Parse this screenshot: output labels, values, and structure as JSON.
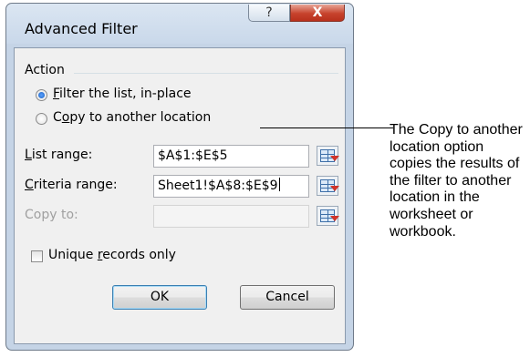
{
  "dialog": {
    "title": "Advanced Filter",
    "help_glyph": "?",
    "close_glyph": "X"
  },
  "action": {
    "label": "Action",
    "radio_filter": {
      "pre": "",
      "accel": "F",
      "post": "ilter the list, in-place",
      "selected": true
    },
    "radio_copy": {
      "pre": "C",
      "accel": "o",
      "post": "py to another location",
      "selected": false
    }
  },
  "list_range": {
    "pre": "",
    "accel": "L",
    "post": "ist range:",
    "value": "$A$1:$E$5"
  },
  "criteria_range": {
    "pre": "",
    "accel": "C",
    "post": "riteria range:",
    "value": "Sheet1!$A$8:$E$9"
  },
  "copy_to": {
    "label": "Copy to:",
    "value": "",
    "disabled": true
  },
  "unique": {
    "pre": "Unique ",
    "accel": "r",
    "post": "ecords only",
    "checked": false
  },
  "buttons": {
    "ok": "OK",
    "cancel": "Cancel"
  },
  "callout": {
    "text": "The Copy to another location option copies the results of the filter to another location in the worksheet or workbook."
  },
  "colors": {
    "accent": "#1b5fc0",
    "close": "#c7422c",
    "titlebar": "#c9d8ea"
  }
}
